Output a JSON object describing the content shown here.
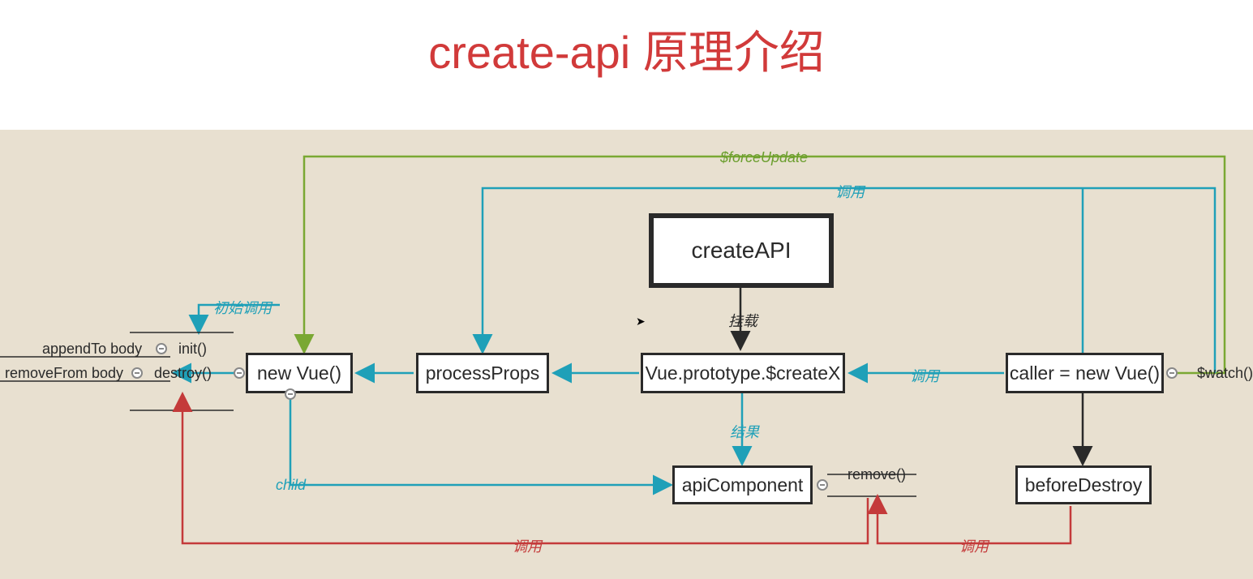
{
  "title": "create-api 原理介绍",
  "nodes": {
    "createAPI": "createAPI",
    "newVue": "new Vue()",
    "processProps": "processProps",
    "prototype": "Vue.prototype.$createX",
    "caller": "caller = new Vue()",
    "apiComponent": "apiComponent",
    "beforeDestroy": "beforeDestroy"
  },
  "labels": {
    "forceUpdate": "$forceUpdate",
    "call_top": "调用",
    "initial_call": "初始调用",
    "mount": "挂载",
    "call_mid": "调用",
    "result": "结果",
    "child": "child",
    "call_bottom1": "调用",
    "call_bottom2": "调用",
    "watch": "$watch()",
    "init": "init()",
    "destroy": "destroy()",
    "appendTo": "appendTo body",
    "removeFrom": "removeFrom body",
    "remove": "remove()"
  }
}
